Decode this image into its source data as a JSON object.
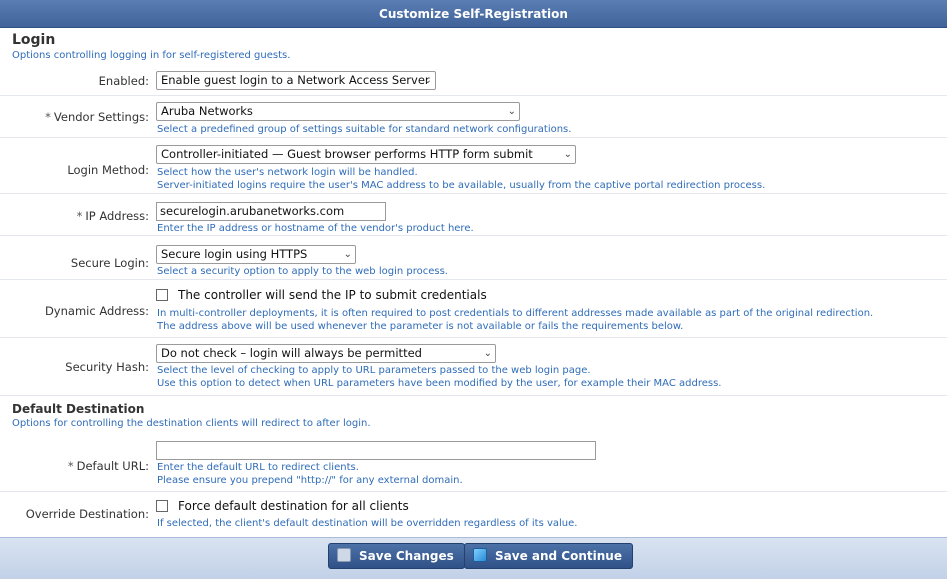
{
  "header": {
    "title": "Customize Self-Registration"
  },
  "login": {
    "title": "Login",
    "description": "Options controlling logging in for self-registered guests.",
    "enabled": {
      "label": "Enabled:",
      "value": "Enable guest login to a Network Access Server"
    },
    "vendor": {
      "label": "Vendor Settings:",
      "value": "Aruba Networks",
      "help": "Select a predefined group of settings suitable for standard network configurations."
    },
    "method": {
      "label": "Login Method:",
      "value": "Controller-initiated — Guest browser performs HTTP form submit",
      "help1": "Select how the user's network login will be handled.",
      "help2": "Server-initiated logins require the user's MAC address to be available, usually from the captive portal redirection process."
    },
    "ip": {
      "label": "IP Address:",
      "value": "securelogin.arubanetworks.com",
      "help": "Enter the IP address or hostname of the vendor's product here."
    },
    "secure": {
      "label": "Secure Login:",
      "value": "Secure login using HTTPS",
      "help": "Select a security option to apply to the web login process."
    },
    "dynamic": {
      "label": "Dynamic Address:",
      "checkbox_label": "The controller will send the IP to submit credentials",
      "help1": "In multi-controller deployments, it is often required to post credentials to different addresses made available as part of the original redirection.",
      "help2": "The address above will be used whenever the parameter is not available or fails the requirements below."
    },
    "hash": {
      "label": "Security Hash:",
      "value": "Do not check – login will always be permitted",
      "help1": "Select the level of checking to apply to URL parameters passed to the web login page.",
      "help2": "Use this option to detect when URL parameters have been modified by the user, for example their MAC address."
    }
  },
  "destination": {
    "title": "Default Destination",
    "description": "Options for controlling the destination clients will redirect to after login.",
    "url": {
      "label": "Default URL:",
      "value": "",
      "help1": "Enter the default URL to redirect clients.",
      "help2": "Please ensure you prepend \"http://\" for any external domain."
    },
    "override": {
      "label": "Override Destination:",
      "checkbox_label": "Force default destination for all clients",
      "help": "If selected, the client's default destination will be overridden regardless of its value."
    }
  },
  "footer": {
    "save_label": "Save Changes",
    "continue_label": "Save and Continue"
  },
  "glyphs": {
    "required": "*",
    "chevron": "⌄"
  }
}
